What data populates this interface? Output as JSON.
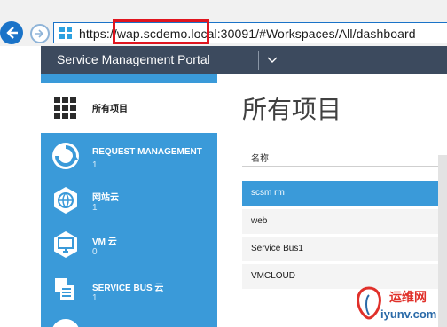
{
  "browser": {
    "url": "https://wap.scdemo.local:30091/#Workspaces/All/dashboard"
  },
  "header": {
    "title": "Service Management Portal"
  },
  "sidebar": {
    "items": [
      {
        "label": "所有项目",
        "count": "",
        "icon": "grid-icon"
      },
      {
        "label": "REQUEST MANAGEMENT",
        "count": "1",
        "icon": "recycle-arrows-icon"
      },
      {
        "label": "网站云",
        "count": "1",
        "icon": "globe-icon"
      },
      {
        "label": "VM 云",
        "count": "0",
        "icon": "monitor-icon"
      },
      {
        "label": "SERVICE BUS 云",
        "count": "1",
        "icon": "service-bus-icon"
      }
    ]
  },
  "main": {
    "title": "所有项目",
    "column_header": "名称",
    "rows": [
      "scsm rm",
      "web",
      "Service Bus1",
      "VMCLOUD"
    ]
  },
  "watermark": {
    "text1": "运维网",
    "text2": "iyunv.com"
  },
  "colors": {
    "sidebar": "#3a9ad9",
    "header": "#3c4a5e",
    "highlight": "#e0151f"
  }
}
